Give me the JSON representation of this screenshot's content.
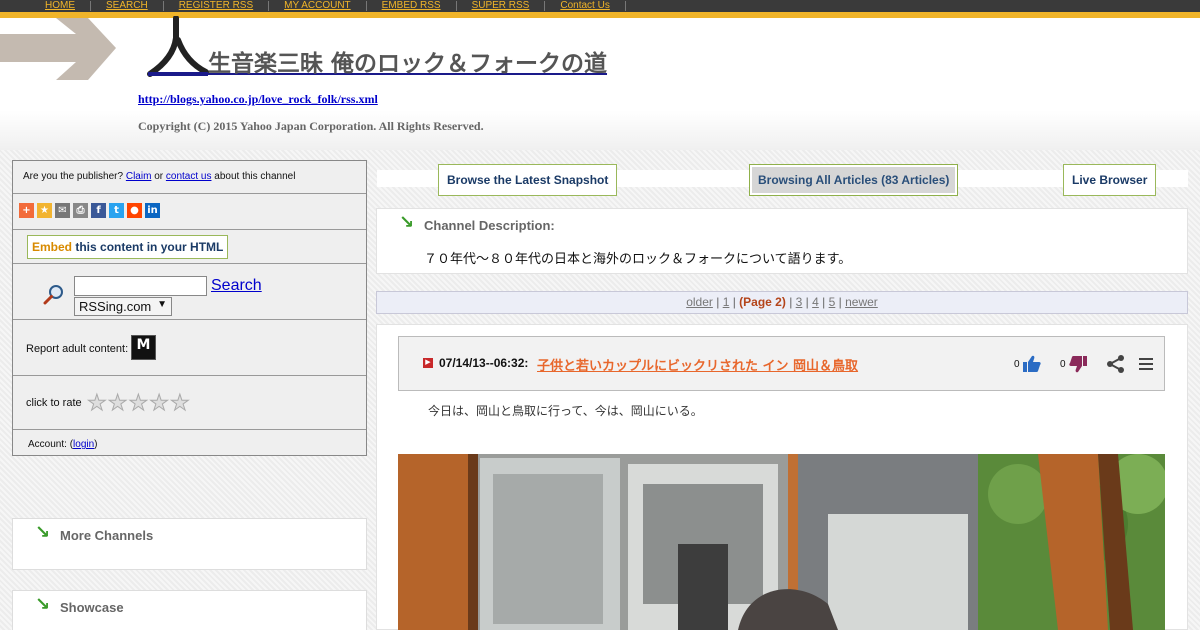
{
  "nav": [
    "HOME",
    "SEARCH",
    "REGISTER RSS",
    "MY ACCOUNT",
    "EMBED RSS",
    "SUPER RSS",
    "Contact Us"
  ],
  "header": {
    "title": "生音楽三昧 俺のロック＆フォークの道",
    "feed_url": "http://blogs.yahoo.co.jp/love_rock_folk/rss.xml",
    "copyright": "Copyright (C) 2015 Yahoo Japan Corporation. All Rights Reserved."
  },
  "sidebar": {
    "publisher_prefix": "Are you the publisher?",
    "claim": "Claim",
    "or": "or",
    "contact": "contact us",
    "publisher_suffix": "about this channel",
    "embed_highlight": "Embed",
    "embed_rest": "this content in your HTML",
    "search_label": "Search",
    "search_select": "RSSing.com",
    "adult_label": "Report adult content:",
    "rate_label": "click to rate",
    "rating": 0,
    "account_label": "Account:",
    "login": "login",
    "more_channels": "More Channels",
    "showcase": "Showcase",
    "colors": {
      "addthis": "#f26b3a",
      "favorite": "#f2b430",
      "email": "#777777",
      "print": "#888888",
      "facebook": "#3b5998",
      "twitter": "#2aa3ef",
      "reddit": "#ff4500",
      "linkedin": "#0a66c2"
    }
  },
  "tabs": {
    "latest": "Browse the Latest Snapshot",
    "all": "Browsing All Articles (83 Articles)",
    "live": "Live Browser"
  },
  "description": {
    "title": "Channel Description:",
    "text": "７０年代～８０年代の日本と海外のロック＆フォークについて語ります。"
  },
  "pager": {
    "older": "older",
    "p1": "1",
    "current": "(Page 2)",
    "p3": "3",
    "p4": "4",
    "p5": "5",
    "newer": "newer"
  },
  "article": {
    "date": "07/14/13--06:32:",
    "title": "子供と若いカップルにビックリされた イン 岡山＆鳥取",
    "likes": "0",
    "dislikes": "0",
    "excerpt": "今日は、岡山と鳥取に行って、今は、岡山にいる。"
  }
}
